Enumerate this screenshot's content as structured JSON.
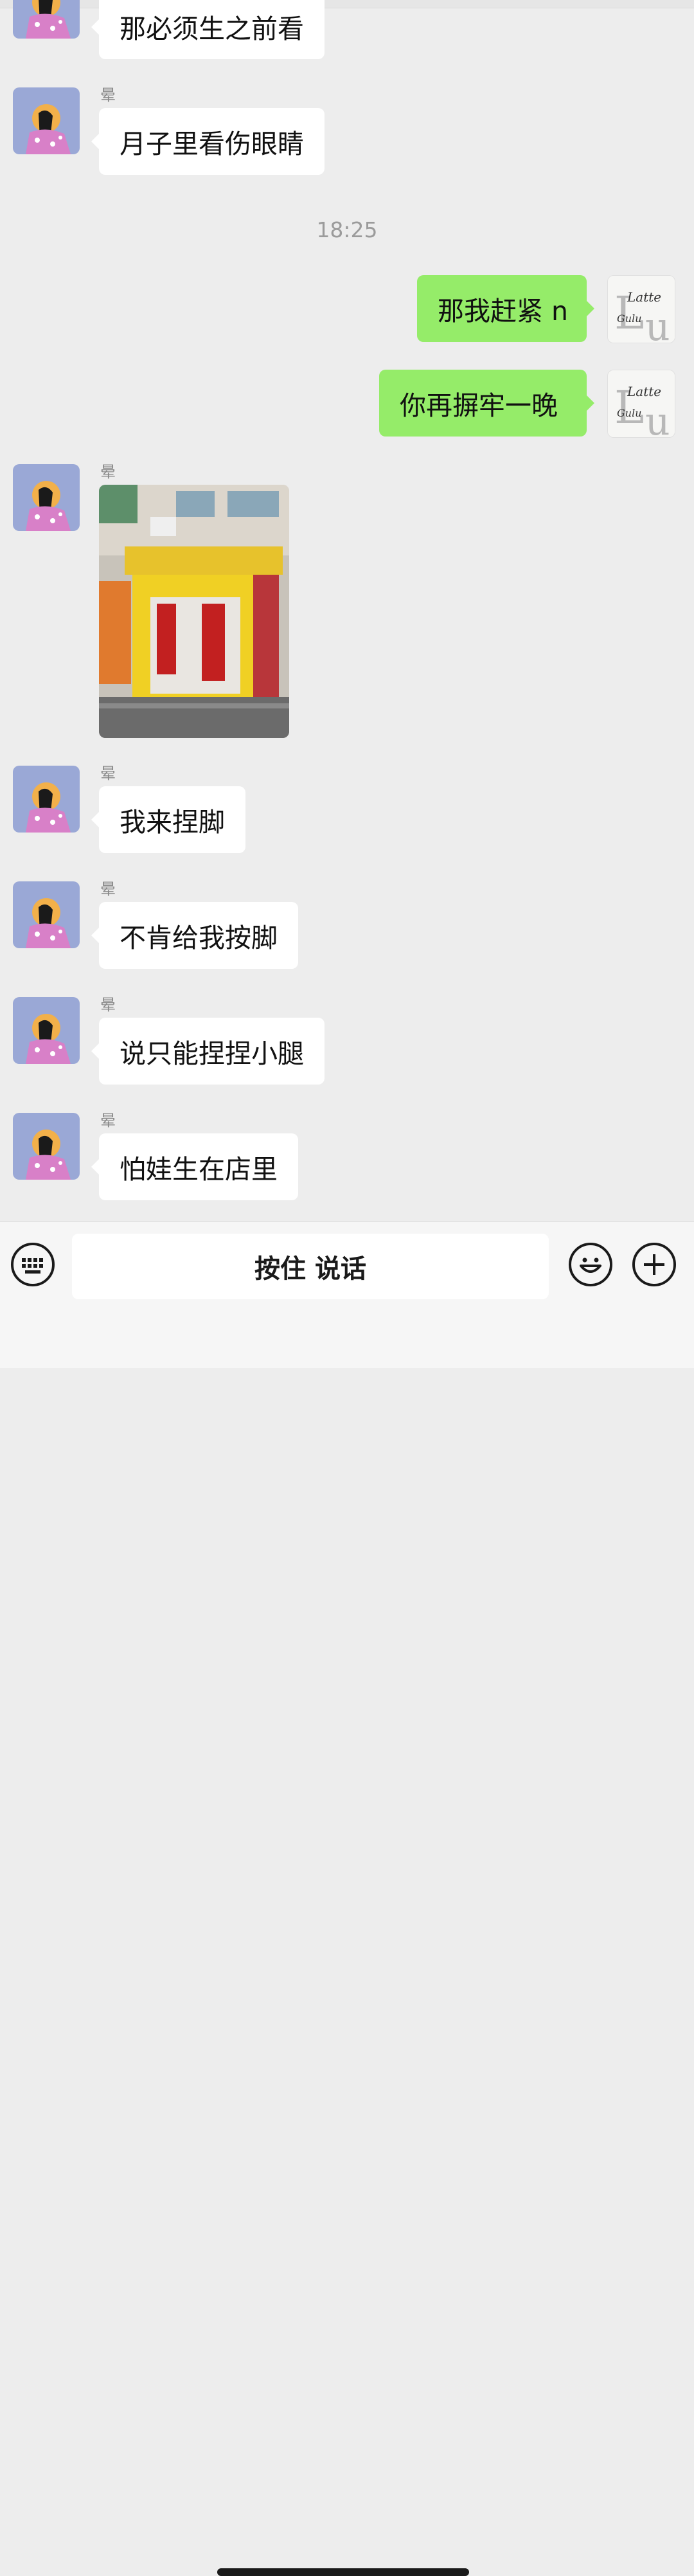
{
  "contact": {
    "name": "晕"
  },
  "timestamp": "18:25",
  "messages": [
    {
      "text": "那必须生之前看"
    },
    {
      "text": "月子里看伤眼睛"
    },
    {
      "text": "那我赶紧 n"
    },
    {
      "text": "你再摒牢一晚"
    },
    {
      "text": "我来捏脚"
    },
    {
      "text": "不肯给我按脚"
    },
    {
      "text": "说只能捏捏小腿"
    },
    {
      "text": "怕娃生在店里"
    }
  ],
  "my_avatar": {
    "line1": "Latte",
    "line2": "Gulu",
    "big1": "L",
    "big2": "u"
  },
  "input_bar": {
    "voice_label": "按住 说话"
  },
  "colors": {
    "background": "#ededed",
    "incoming_bubble": "#ffffff",
    "outgoing_bubble": "#95ec69",
    "their_avatar_bg": "#9aa8d6"
  },
  "icons": {
    "keyboard": "keyboard-icon",
    "emoji": "emoji-icon",
    "plus": "plus-icon"
  }
}
